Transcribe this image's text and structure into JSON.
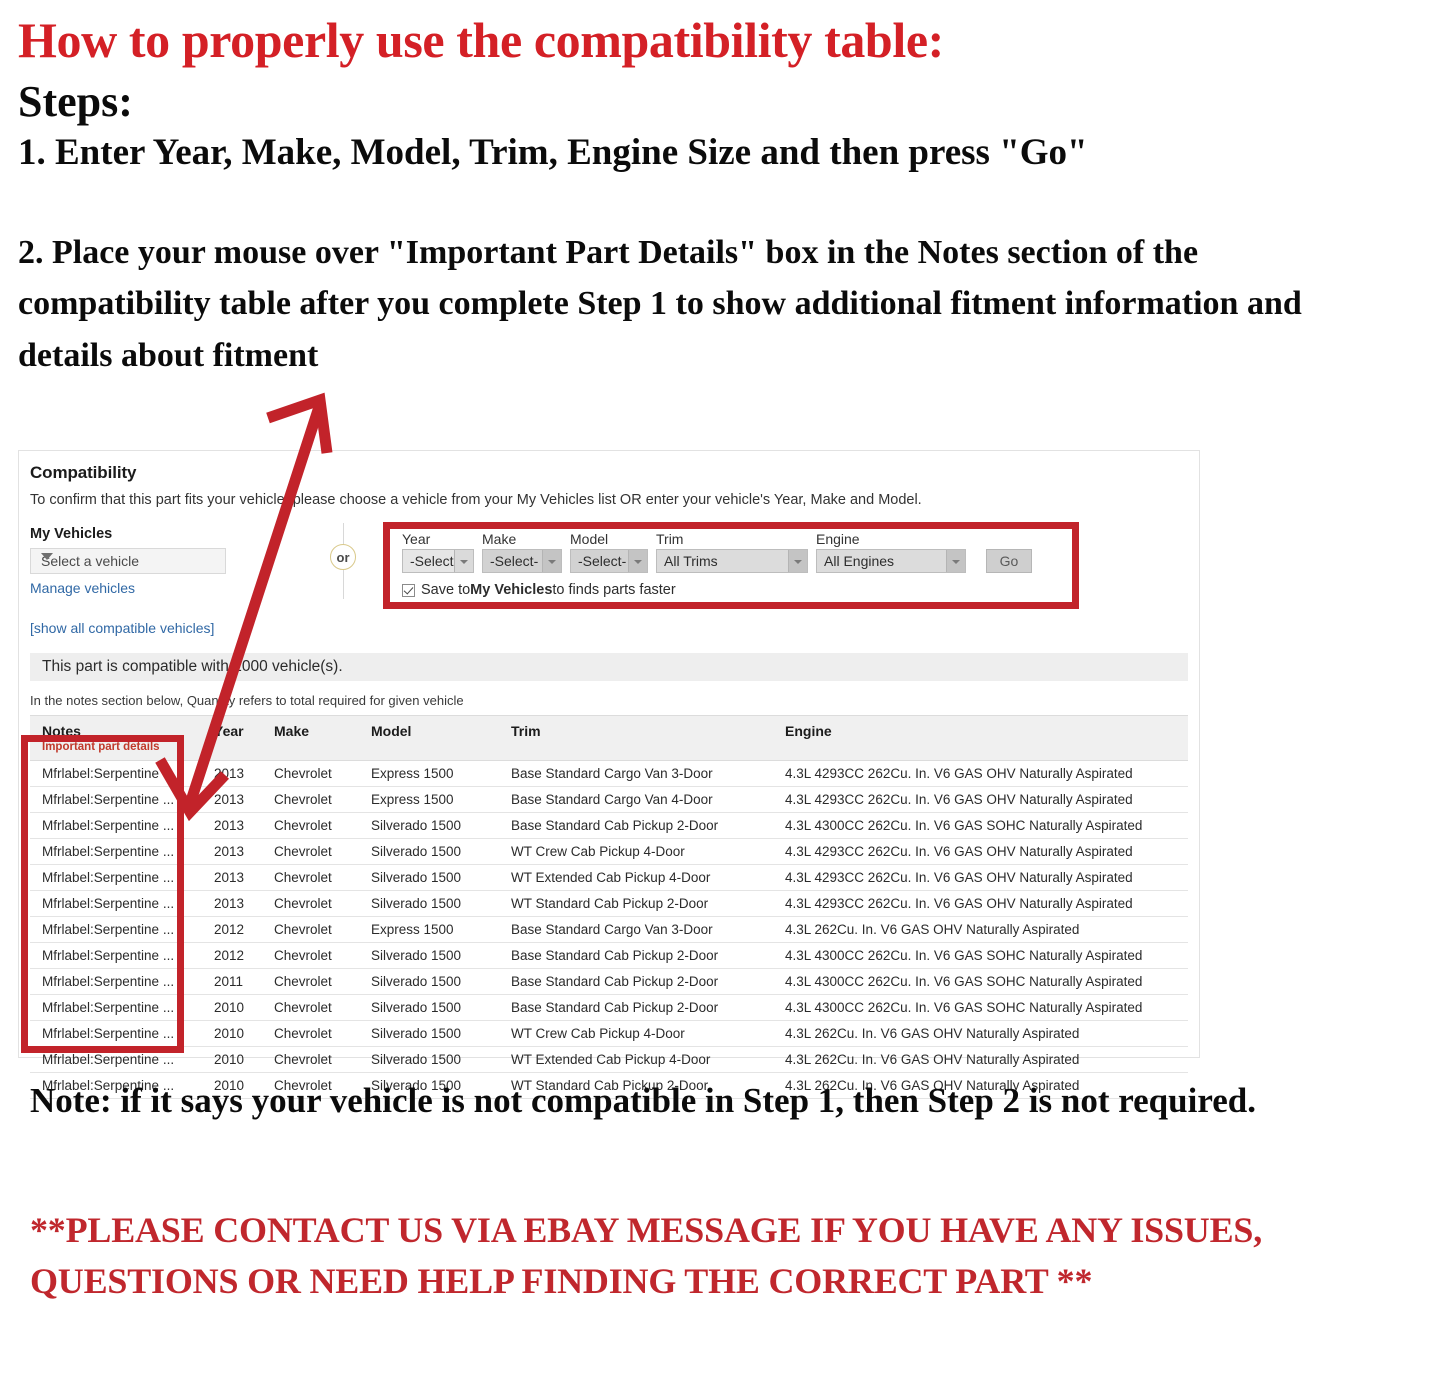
{
  "headline": {
    "title": "How to properly use the compatibility table:",
    "steps_label": "Steps:",
    "step1": "1. Enter Year, Make, Model, Trim, Engine Size and then press \"Go\"",
    "step2": "2. Place your mouse over \"Important Part Details\" box in the Notes section of the compatibility table after you complete Step 1 to show additional fitment information and details about fitment"
  },
  "compatibility": {
    "title": "Compatibility",
    "description": "To confirm that this part fits your vehicle, please choose a vehicle from your My Vehicles list OR enter your vehicle's Year, Make and Model.",
    "my_vehicles": {
      "label": "My Vehicles",
      "select_value": "Select a vehicle",
      "manage_link": "Manage vehicles",
      "show_all_link": "[show all compatible vehicles]"
    },
    "or_label": "or",
    "finder": {
      "fields": [
        {
          "label": "Year",
          "value": "-Select-"
        },
        {
          "label": "Make",
          "value": "-Select-"
        },
        {
          "label": "Model",
          "value": "-Select-"
        },
        {
          "label": "Trim",
          "value": "All Trims"
        },
        {
          "label": "Engine",
          "value": "All Engines"
        }
      ],
      "go_label": "Go",
      "save_prefix": "Save to ",
      "save_bold": "My Vehicles",
      "save_suffix": " to finds parts faster",
      "save_checked": true
    },
    "compatible_bar": "This part is compatible with 1000 vehicle(s).",
    "notes_hint": "In the notes section below, Quantity refers to total required for given vehicle",
    "table": {
      "headers": {
        "notes": "Notes",
        "notes_sub": "Important part details",
        "year": "Year",
        "make": "Make",
        "model": "Model",
        "trim": "Trim",
        "engine": "Engine"
      },
      "rows": [
        {
          "notes": "Mfrlabel:Serpentine ...",
          "year": "2013",
          "make": "Chevrolet",
          "model": "Express 1500",
          "trim": "Base Standard Cargo Van 3-Door",
          "engine": "4.3L 4293CC 262Cu. In. V6 GAS OHV Naturally Aspirated"
        },
        {
          "notes": "Mfrlabel:Serpentine ...",
          "year": "2013",
          "make": "Chevrolet",
          "model": "Express 1500",
          "trim": "Base Standard Cargo Van 4-Door",
          "engine": "4.3L 4293CC 262Cu. In. V6 GAS OHV Naturally Aspirated"
        },
        {
          "notes": "Mfrlabel:Serpentine ...",
          "year": "2013",
          "make": "Chevrolet",
          "model": "Silverado 1500",
          "trim": "Base Standard Cab Pickup 2-Door",
          "engine": "4.3L 4300CC 262Cu. In. V6 GAS SOHC Naturally Aspirated"
        },
        {
          "notes": "Mfrlabel:Serpentine ...",
          "year": "2013",
          "make": "Chevrolet",
          "model": "Silverado 1500",
          "trim": "WT Crew Cab Pickup 4-Door",
          "engine": "4.3L 4293CC 262Cu. In. V6 GAS OHV Naturally Aspirated"
        },
        {
          "notes": "Mfrlabel:Serpentine ...",
          "year": "2013",
          "make": "Chevrolet",
          "model": "Silverado 1500",
          "trim": "WT Extended Cab Pickup 4-Door",
          "engine": "4.3L 4293CC 262Cu. In. V6 GAS OHV Naturally Aspirated"
        },
        {
          "notes": "Mfrlabel:Serpentine ...",
          "year": "2013",
          "make": "Chevrolet",
          "model": "Silverado 1500",
          "trim": "WT Standard Cab Pickup 2-Door",
          "engine": "4.3L 4293CC 262Cu. In. V6 GAS OHV Naturally Aspirated"
        },
        {
          "notes": "Mfrlabel:Serpentine ...",
          "year": "2012",
          "make": "Chevrolet",
          "model": "Express 1500",
          "trim": "Base Standard Cargo Van 3-Door",
          "engine": "4.3L 262Cu. In. V6 GAS OHV Naturally Aspirated"
        },
        {
          "notes": "Mfrlabel:Serpentine ...",
          "year": "2012",
          "make": "Chevrolet",
          "model": "Silverado 1500",
          "trim": "Base Standard Cab Pickup 2-Door",
          "engine": "4.3L 4300CC 262Cu. In. V6 GAS SOHC Naturally Aspirated"
        },
        {
          "notes": "Mfrlabel:Serpentine ...",
          "year": "2011",
          "make": "Chevrolet",
          "model": "Silverado 1500",
          "trim": "Base Standard Cab Pickup 2-Door",
          "engine": "4.3L 4300CC 262Cu. In. V6 GAS SOHC Naturally Aspirated"
        },
        {
          "notes": "Mfrlabel:Serpentine ...",
          "year": "2010",
          "make": "Chevrolet",
          "model": "Silverado 1500",
          "trim": "Base Standard Cab Pickup 2-Door",
          "engine": "4.3L 4300CC 262Cu. In. V6 GAS SOHC Naturally Aspirated"
        },
        {
          "notes": "Mfrlabel:Serpentine ...",
          "year": "2010",
          "make": "Chevrolet",
          "model": "Silverado 1500",
          "trim": "WT Crew Cab Pickup 4-Door",
          "engine": "4.3L 262Cu. In. V6 GAS OHV Naturally Aspirated"
        },
        {
          "notes": "Mfrlabel:Serpentine ...",
          "year": "2010",
          "make": "Chevrolet",
          "model": "Silverado 1500",
          "trim": "WT Extended Cab Pickup 4-Door",
          "engine": "4.3L 262Cu. In. V6 GAS OHV Naturally Aspirated"
        },
        {
          "notes": "Mfrlabel:Serpentine ...",
          "year": "2010",
          "make": "Chevrolet",
          "model": "Silverado 1500",
          "trim": "WT Standard Cab Pickup 2-Door",
          "engine": "4.3L 262Cu. In. V6 GAS OHV Naturally Aspirated"
        }
      ]
    }
  },
  "footer": {
    "note": "Note: if it says your vehicle is not compatible in Step 1, then Step 2 is not required.",
    "contact": "**PLEASE CONTACT US VIA EBAY MESSAGE IF YOU HAVE ANY ISSUES, QUESTIONS OR NEED HELP FINDING THE CORRECT PART **"
  },
  "colors": {
    "headline_red": "#d42026",
    "annotation_red": "#c2232a",
    "contact_red": "#c0272d",
    "link_blue": "#3068a5"
  }
}
